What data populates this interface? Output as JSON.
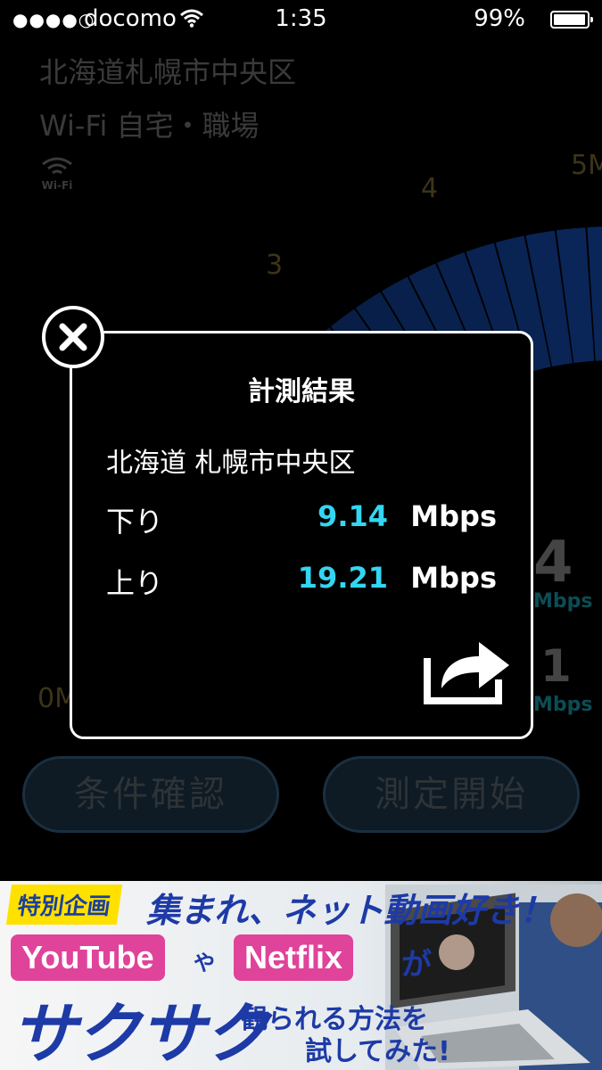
{
  "status_bar": {
    "signal": "●●●●○",
    "carrier": "docomo",
    "time": "1:35",
    "battery_percent": "99%"
  },
  "background": {
    "location": "北海道札幌市中央区",
    "network": "Wi-Fi 自宅・職場",
    "wifi_badge": "Wi-Fi",
    "gauge_labels": {
      "zero": "0M",
      "three": "3",
      "four": "4",
      "five": "5M"
    },
    "download_partial": "4",
    "upload_partial": "1",
    "mbps_unit": "Mbps",
    "buttons": {
      "conditions": "条件確認",
      "start": "測定開始"
    }
  },
  "modal": {
    "title": "計測結果",
    "location": "北海道 札幌市中央区",
    "download": {
      "label": "下り",
      "value": "9.14",
      "unit": "Mbps"
    },
    "upload": {
      "label": "上り",
      "value": "19.21",
      "unit": "Mbps"
    }
  },
  "ad": {
    "tag": "特別企画",
    "headline": "集まれ、ネット動画好き！",
    "pill_youtube": "YouTube",
    "connector_ya": "や",
    "pill_netflix": "Netflix",
    "connector_ga": "が",
    "big_text": "サクサク",
    "sub_line1": "観られる方法を",
    "sub_line2": "試してみた!"
  },
  "colors": {
    "accent_value": "#33d6f0",
    "gauge_blue": "#0b2a63",
    "ad_blue": "#1d3aa6",
    "ad_pink": "#e0439a",
    "ad_yellow": "#ffe100"
  }
}
